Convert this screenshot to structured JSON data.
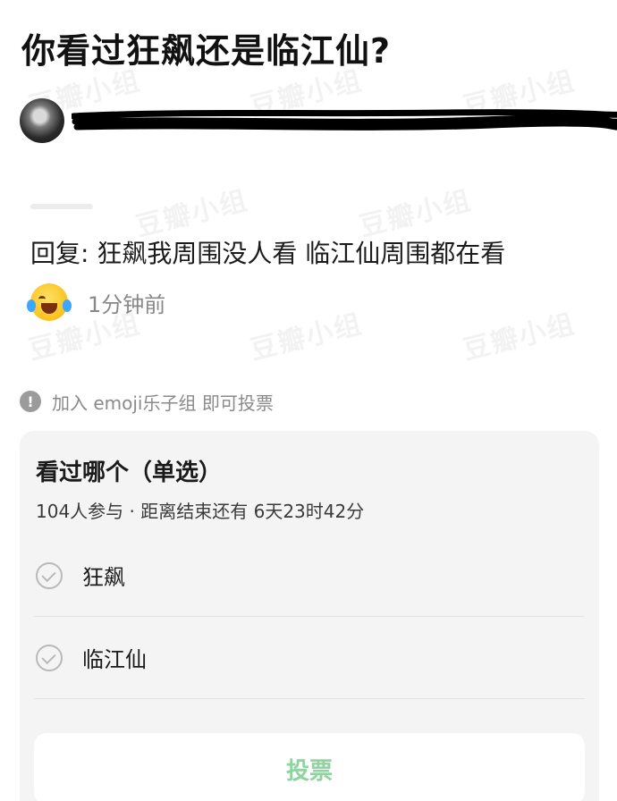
{
  "post": {
    "title": "你看过狂飙还是临江仙?",
    "reply": "回复: 狂飙我周围没人看 临江仙周围都在看",
    "time": "1分钟前"
  },
  "notice": {
    "icon": "exclamation-icon",
    "text": "加入 emoji乐子组 即可投票"
  },
  "poll": {
    "title": "看过哪个（单选）",
    "meta": "104人参与 · 距离结束还有 6天23时42分",
    "options": [
      {
        "label": "狂飙"
      },
      {
        "label": "临江仙"
      }
    ],
    "vote_label": "投票"
  },
  "watermark": "豆瓣小组",
  "colors": {
    "vote_text": "#8fd39f",
    "poll_bg": "#f4f4f4",
    "muted": "#8a8a8a"
  }
}
